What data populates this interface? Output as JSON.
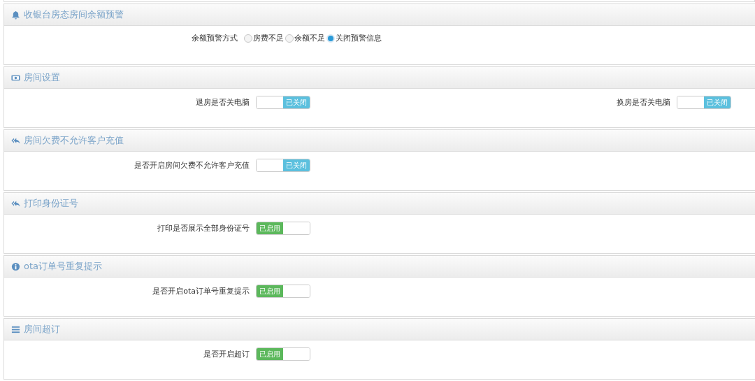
{
  "panels": [
    {
      "kind": "bell",
      "title": "收银台房态房间余额预警",
      "rows": [
        {
          "kind": "radio",
          "label": "余额预警方式",
          "options": [
            {
              "label": "房费不足",
              "selected": false
            },
            {
              "label": "余额不足",
              "selected": false
            },
            {
              "label": "关闭预警信息",
              "selected": true
            }
          ]
        }
      ]
    },
    {
      "kind": "money",
      "title": "房间设置",
      "rows": [
        {
          "kind": "switch",
          "label": "退房是否关电脑",
          "on": false,
          "state_text": "已关闭"
        },
        {
          "kind": "switch",
          "label": "换房是否关电脑",
          "on": false,
          "state_text": "已关闭"
        }
      ]
    },
    {
      "kind": "reply",
      "title": "房间欠费不允许客户充值",
      "rows": [
        {
          "kind": "switch",
          "label": "是否开启房间欠费不允许客户充值",
          "on": false,
          "state_text": "已关闭"
        }
      ]
    },
    {
      "kind": "reply",
      "title": "打印身份证号",
      "rows": [
        {
          "kind": "switch",
          "label": "打印是否展示全部身份证号",
          "on": true,
          "state_text": "已启用"
        }
      ]
    },
    {
      "kind": "info",
      "title": "ota订单号重复提示",
      "rows": [
        {
          "kind": "switch",
          "label": "是否开启ota订单号重复提示",
          "on": true,
          "state_text": "已启用"
        }
      ]
    },
    {
      "kind": "bars",
      "title": "房间超订",
      "rows": [
        {
          "kind": "switch",
          "label": "是否开启超订",
          "on": true,
          "state_text": "已启用"
        }
      ]
    }
  ]
}
